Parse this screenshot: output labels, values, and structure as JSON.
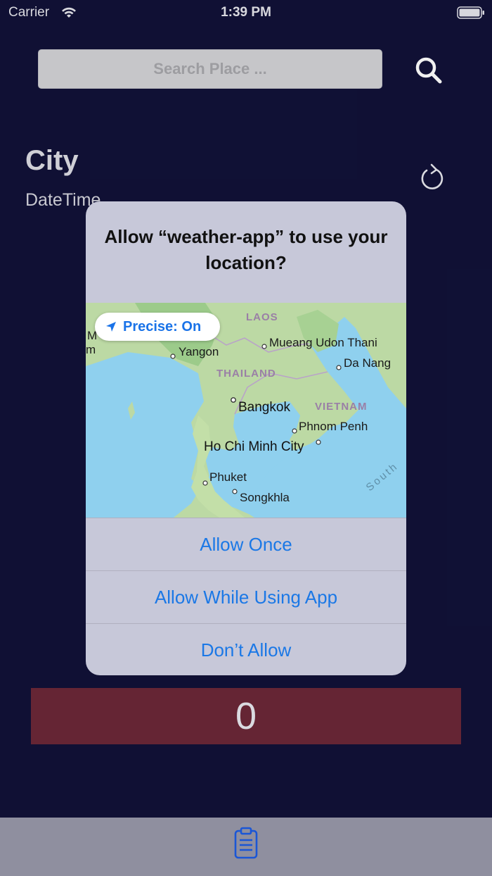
{
  "status_bar": {
    "carrier": "Carrier",
    "time": "1:39 PM"
  },
  "search": {
    "placeholder": "Search Place ..."
  },
  "weather": {
    "city": "City",
    "datetime": "DateTime",
    "count": "0"
  },
  "alert": {
    "title": "Allow “weather-app” to use your location?",
    "precise_label": "Precise: On",
    "buttons": {
      "allow_once": "Allow Once",
      "allow_while_using": "Allow While Using App",
      "dont_allow": "Don’t Allow"
    },
    "map": {
      "countries": [
        "LAOS",
        "THAILAND",
        "VIETNAM"
      ],
      "cities": [
        "Yangon",
        "Mueang Udon Thani",
        "Da Nang",
        "Bangkok",
        "Phnom Penh",
        "Ho Chi Minh City",
        "Phuket",
        "Songkhla"
      ],
      "sea": "South",
      "fragments": [
        "M",
        "m"
      ]
    }
  },
  "colors": {
    "background": "#111238",
    "accent": "#1b78e6",
    "count_bar": "#6c2838",
    "tab_bar": "#8f8f9f"
  },
  "icons": {
    "search": "search-icon",
    "refresh": "refresh-icon",
    "tab": "clipboard-icon",
    "precise": "location-arrow-icon"
  }
}
